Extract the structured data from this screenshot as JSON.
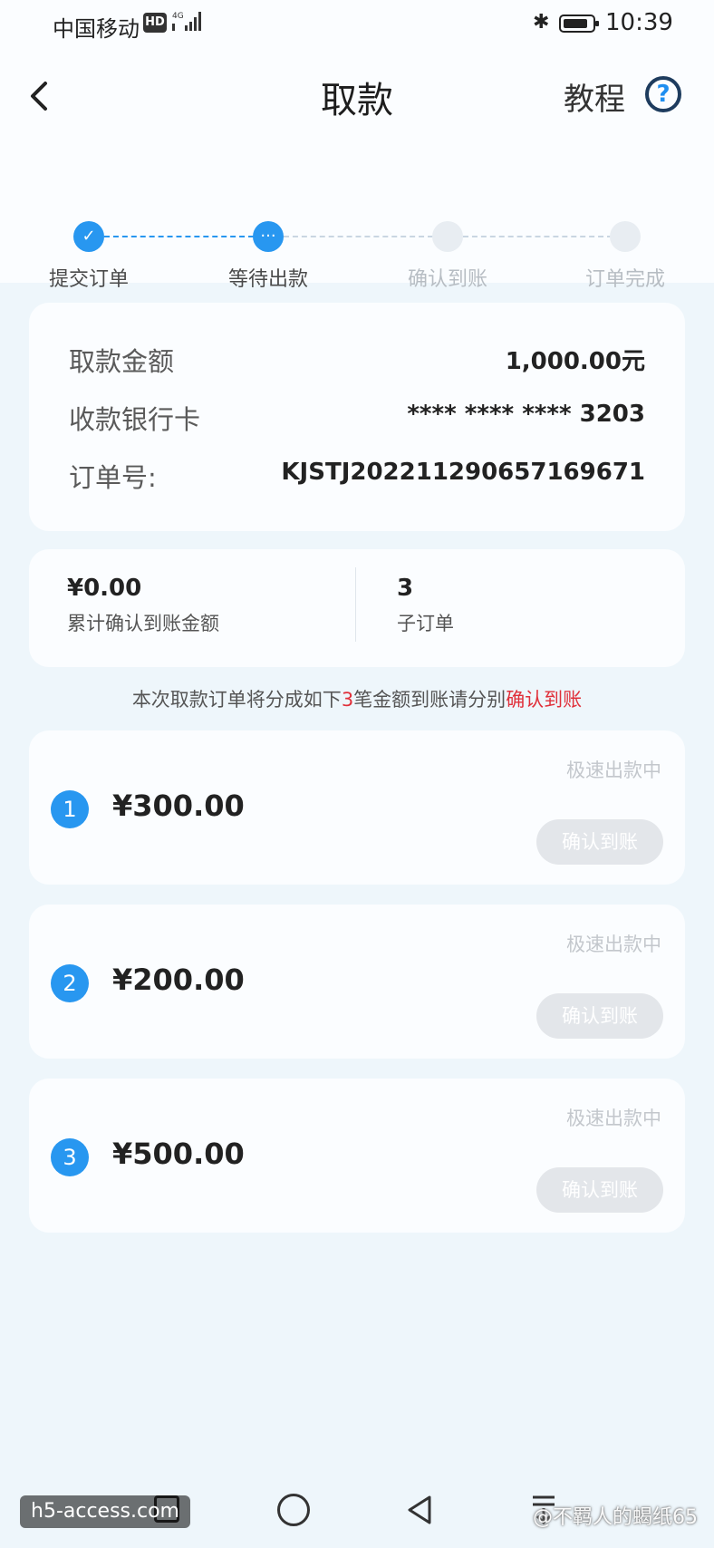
{
  "status_bar": {
    "carrier": "中国移动",
    "hd": "HD",
    "network": "4G",
    "time": "10:39"
  },
  "header": {
    "title": "取款",
    "tutorial_label": "教程",
    "help_glyph": "?"
  },
  "steps": [
    {
      "label": "提交订单",
      "state": "done"
    },
    {
      "label": "等待出款",
      "state": "active"
    },
    {
      "label": "确认到账",
      "state": "todo"
    },
    {
      "label": "订单完成",
      "state": "todo"
    }
  ],
  "withdraw_info": {
    "amount_label": "取款金额",
    "amount_value": "1,000.00元",
    "card_label": "收款银行卡",
    "card_value": "**** **** **** 3203",
    "order_label": "订单号:",
    "order_value": "KJSTJ2022112906571696​71"
  },
  "summary": {
    "confirmed_value": "¥0.00",
    "confirmed_label": "累计确认到账金额",
    "suborders_value": "3",
    "suborders_label": "子订单"
  },
  "notice": {
    "prefix": "本次取款订单将分成如下",
    "count": "3",
    "middle": "笔金额到账请分别",
    "action": "确认到账"
  },
  "sub_orders": [
    {
      "index": "1",
      "amount": "¥300.00",
      "status": "极速出款中",
      "button": "确认到账"
    },
    {
      "index": "2",
      "amount": "¥200.00",
      "status": "极速出款中",
      "button": "确认到账"
    },
    {
      "index": "3",
      "amount": "¥500.00",
      "status": "极速出款中",
      "button": "确认到账"
    }
  ],
  "watermarks": {
    "left": "h5-access.com",
    "right": "@不羁人的蝎纸65"
  },
  "colors": {
    "accent": "#2897f0",
    "highlight": "#e0303a",
    "disabled_button": "#e3e6ea"
  }
}
